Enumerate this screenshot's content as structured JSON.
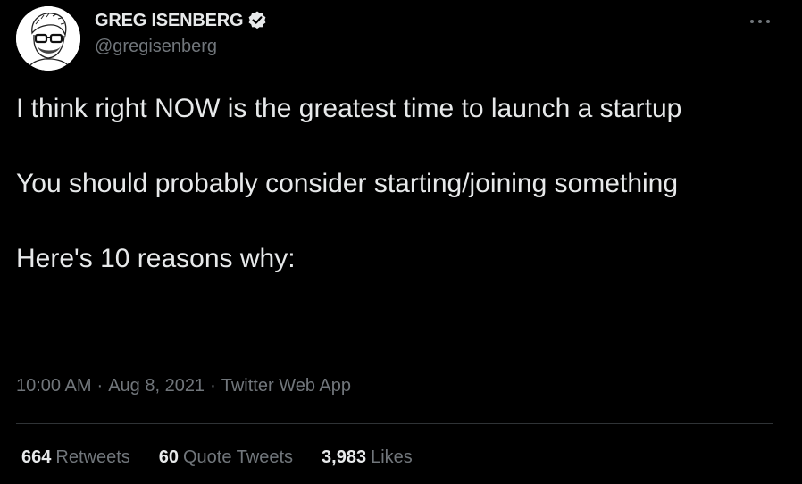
{
  "author": {
    "display_name": "GREG ISENBERG",
    "handle": "@gregisenberg",
    "verified": true,
    "avatar": "avatar-illustration"
  },
  "tweet": {
    "paragraphs": [
      "I think right NOW is the greatest time to launch a startup",
      "You should probably consider starting/joining something",
      "Here's 10 reasons why:"
    ]
  },
  "meta": {
    "time": "10:00 AM",
    "date": "Aug 8, 2021",
    "source": "Twitter Web App",
    "separator": "·"
  },
  "stats": {
    "retweets_count": "664",
    "retweets_label": "Retweets",
    "quote_tweets_count": "60",
    "quote_tweets_label": "Quote Tweets",
    "likes_count": "3,983",
    "likes_label": "Likes"
  },
  "icons": {
    "verified": "verified-badge-icon",
    "more": "more-horizontal-icon"
  },
  "colors": {
    "background": "#000000",
    "primary_text": "#e7e9ea",
    "secondary_text": "#71767b",
    "divider": "#2f3336"
  }
}
